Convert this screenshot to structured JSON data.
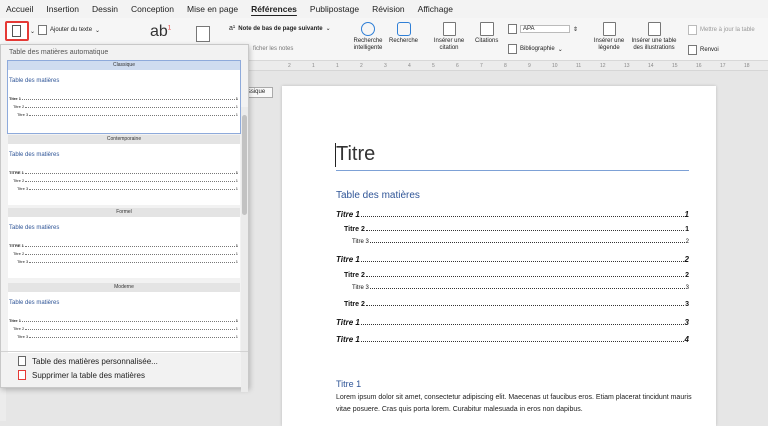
{
  "tabs": [
    "Accueil",
    "Insertion",
    "Dessin",
    "Conception",
    "Mise en page",
    "Références",
    "Publipostage",
    "Révision",
    "Affichage"
  ],
  "ribbon": {
    "add_text": "Ajouter du texte",
    "footnote": "Note de bas de page suivante",
    "show_notes": "ficher les notes",
    "smart_search": "Recherche intelligente",
    "search": "Recherche",
    "insert_citation": "Insérer une citation",
    "citations": "Citations",
    "style": "APA",
    "bibliography": "Bibliographie",
    "insert_caption": "Insérer une légende",
    "insert_table": "Insérer une table des illustrations",
    "update_table": "Mettre à jour la table",
    "cross_ref": "Renvoi",
    "ab": "ab",
    "sup": "1"
  },
  "ruler": [
    "2",
    "1",
    "1",
    "2",
    "3",
    "4",
    "5",
    "6",
    "7",
    "8",
    "9",
    "10",
    "11",
    "12",
    "13",
    "14",
    "15",
    "16",
    "17",
    "18"
  ],
  "dropdown": {
    "header": "Table des matières automatique",
    "tooltip": "Classique",
    "items": [
      {
        "name": "Classique",
        "toc": "Table des matières",
        "lines": [
          {
            "t": "Titre 1",
            "n": "1"
          },
          {
            "t": "Titre 2",
            "n": "1"
          },
          {
            "t": "Titre 3",
            "n": "1"
          }
        ]
      },
      {
        "name": "Contemporaine",
        "toc": "Table des matières",
        "lines": [
          {
            "t": "TITRE 1",
            "n": "1"
          },
          {
            "t": "Titre 2",
            "n": "1"
          },
          {
            "t": "Titre 3",
            "n": "1"
          }
        ]
      },
      {
        "name": "Formel",
        "toc": "Table des matières",
        "lines": [
          {
            "t": "TITRE 1",
            "n": "1"
          },
          {
            "t": "Titre 2",
            "n": "1"
          },
          {
            "t": "Titre 3",
            "n": "1"
          }
        ]
      },
      {
        "name": "Moderne",
        "toc": "Table des matières",
        "lines": [
          {
            "t": "Titre 1",
            "n": "1"
          },
          {
            "t": "Titre 2",
            "n": "1"
          },
          {
            "t": "Titre 3",
            "n": "1"
          }
        ]
      }
    ],
    "custom": "Table des matières personnalisée...",
    "remove": "Supprimer la table des matières"
  },
  "document": {
    "title": "Titre",
    "toc_heading": "Table des matières",
    "toc": [
      {
        "t": "Titre 1",
        "n": "1",
        "l": 1
      },
      {
        "t": "Titre 2",
        "n": "1",
        "l": 2
      },
      {
        "t": "Titre 3",
        "n": "2",
        "l": 3
      },
      {
        "t": "Titre 1",
        "n": "2",
        "l": 1
      },
      {
        "t": "Titre 2",
        "n": "2",
        "l": 2
      },
      {
        "t": "Titre 3",
        "n": "3",
        "l": 3
      },
      {
        "t": "Titre 2",
        "n": "3",
        "l": 2
      },
      {
        "t": "Titre 1",
        "n": "3",
        "l": 1
      },
      {
        "t": "Titre 1",
        "n": "4",
        "l": 1
      }
    ],
    "heading1": "Titre 1",
    "body": "Lorem ipsum dolor sit amet, consectetur adipiscing elit. Maecenas ut faucibus eros. Etiam placerat tincidunt mauris vitae posuere. Cras quis porta lorem. Curabitur malesuada in eros non dapibus."
  },
  "colors": {
    "accent": "#2f5597",
    "highlight": "#e53935"
  }
}
